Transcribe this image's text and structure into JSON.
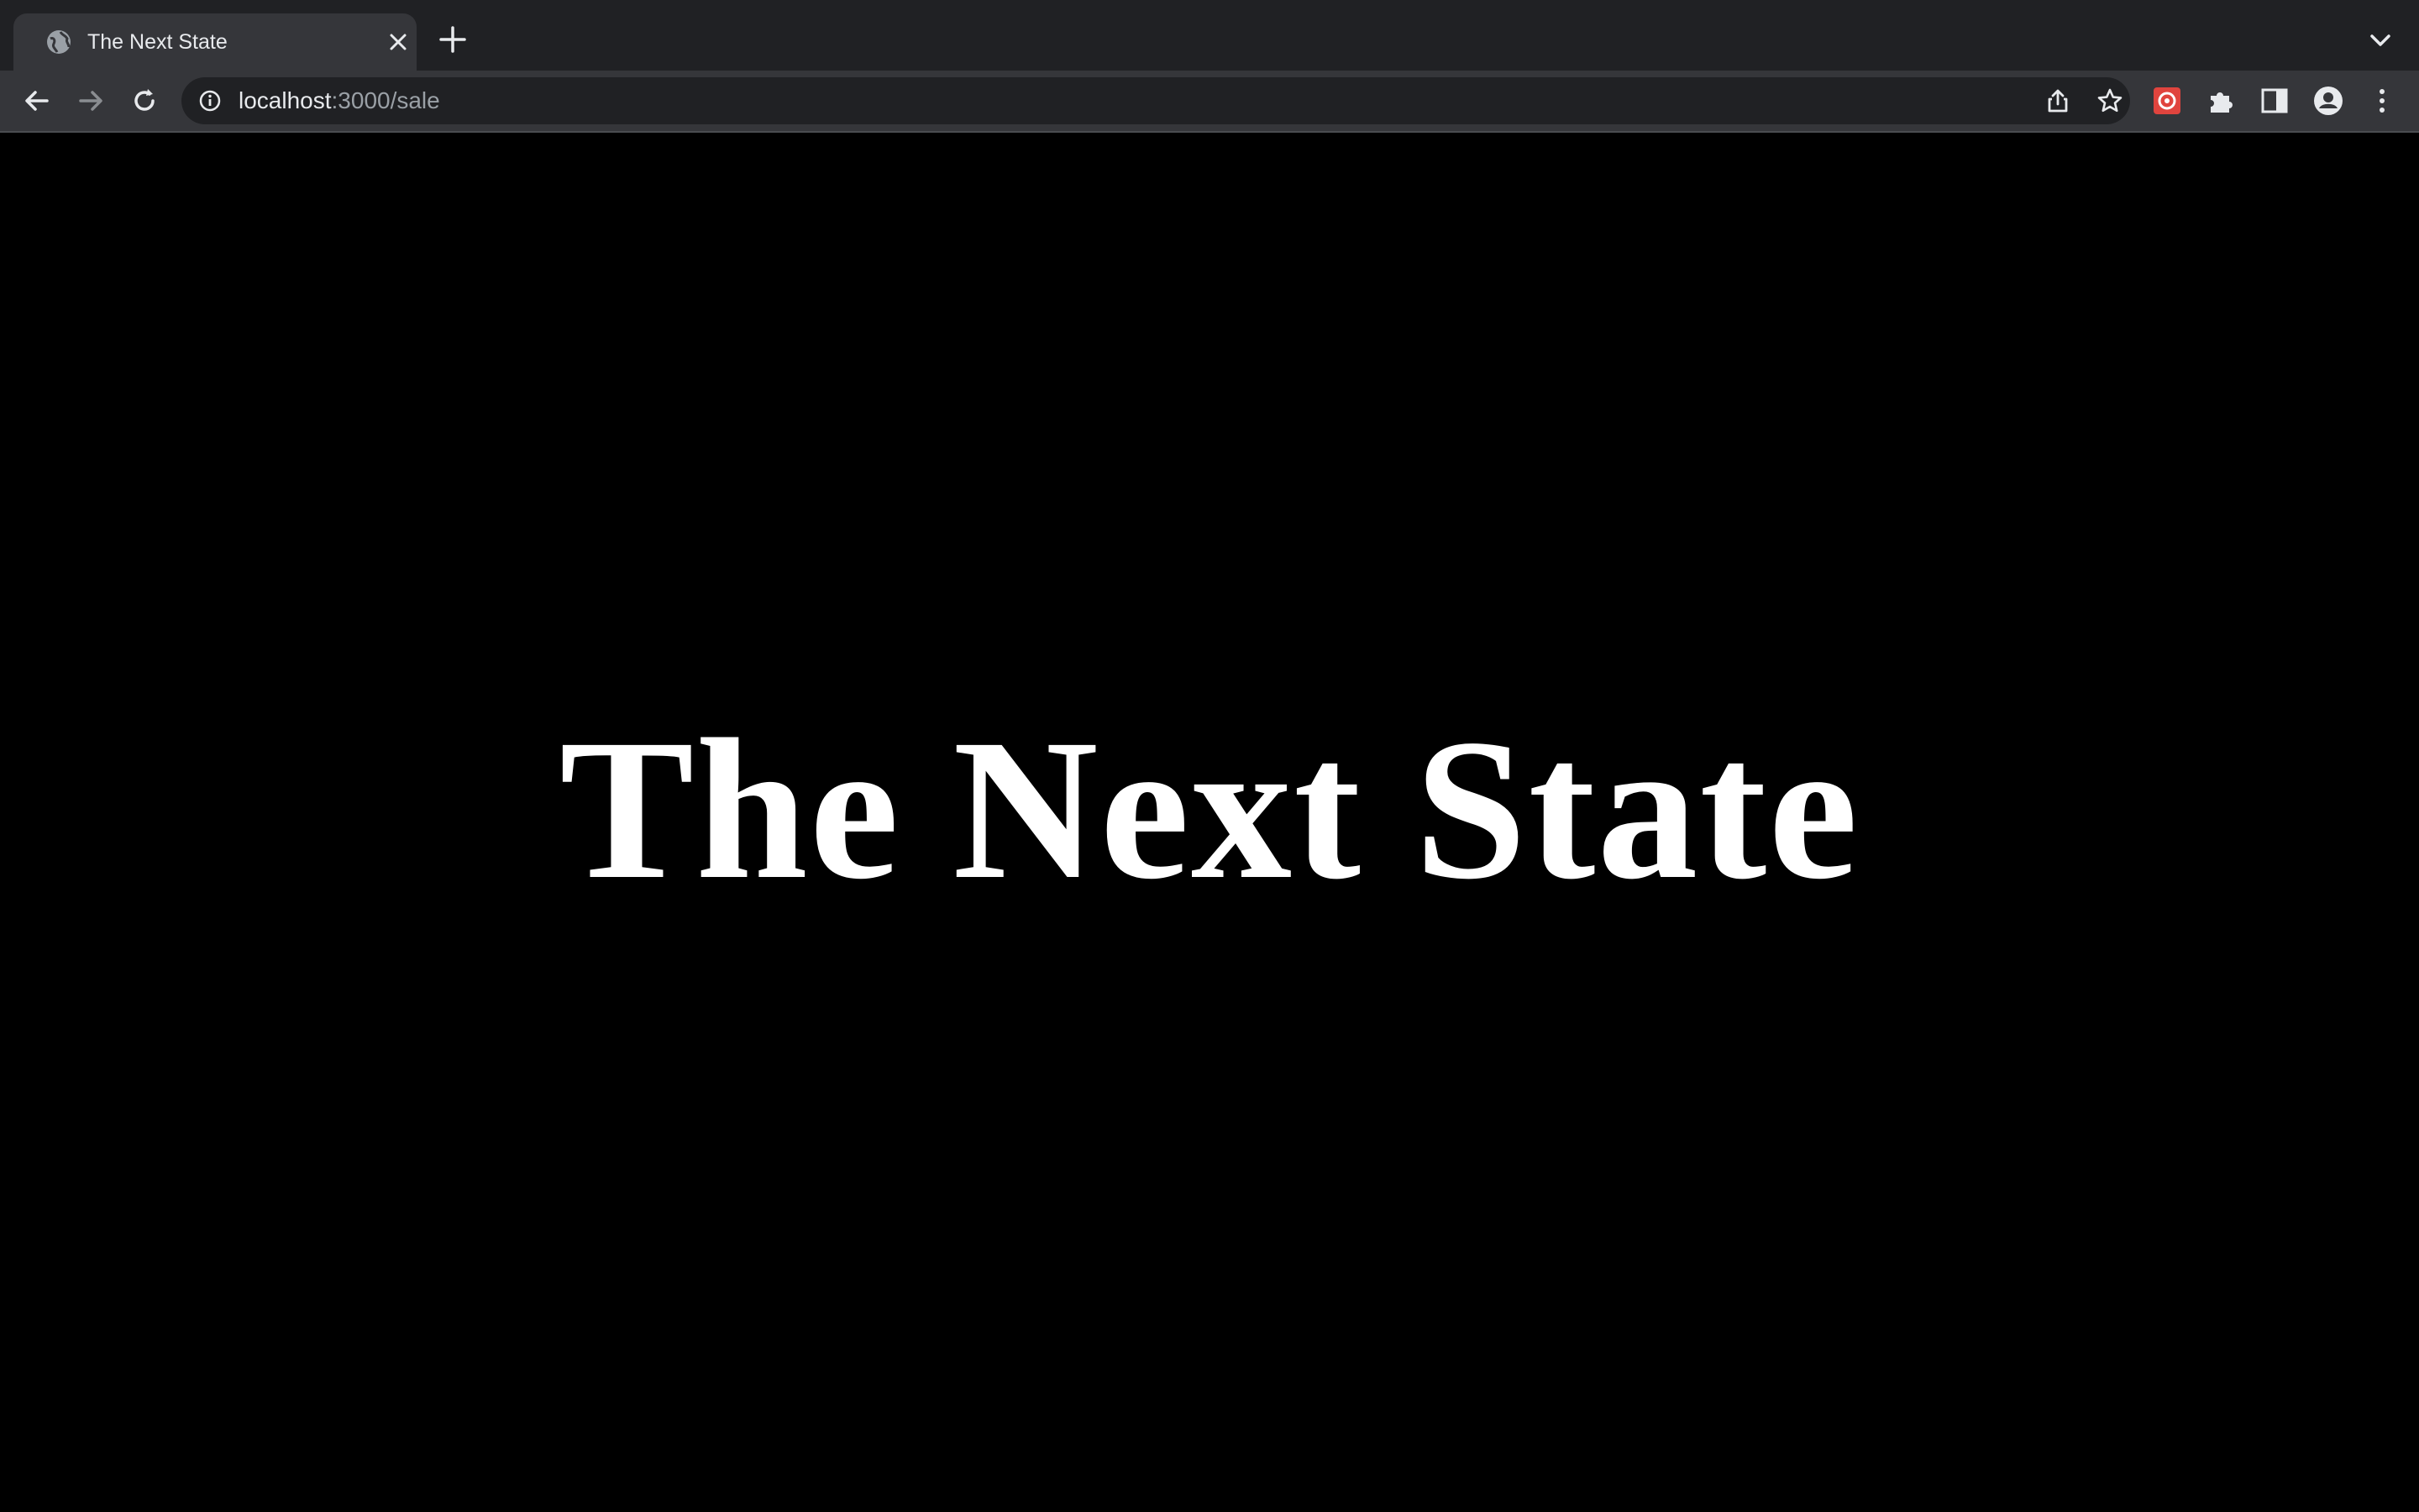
{
  "browser": {
    "tab": {
      "title": "The Next State",
      "favicon": "globe-icon"
    },
    "omnibox": {
      "host": "localhost",
      "path": ":3000/sale"
    },
    "extension_icon_color": "#e0443e"
  },
  "page": {
    "title": "The Next State",
    "background": "#000000",
    "text_color": "#ffffff"
  }
}
